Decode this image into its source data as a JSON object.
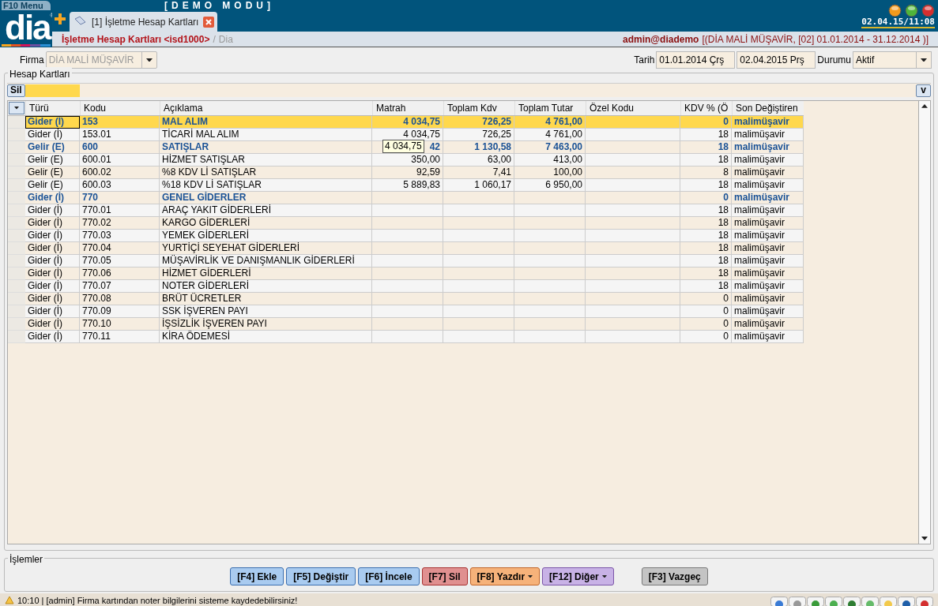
{
  "title_bar": {
    "menu_button": "F10 Menu",
    "mode_banner": "[DEMO MODU]",
    "clock": "02.04.15/11:08"
  },
  "logo": {
    "text": "dia",
    "mark": "®"
  },
  "tabs": [
    {
      "label": "[1] İşletme Hesap Kartları",
      "selected": true
    }
  ],
  "breadcrumb": {
    "title": "İşletme Hesap Kartları <isd1000>",
    "separator": "/",
    "module": "Dia",
    "user": "admin@diademo",
    "context": "[(DİA MALİ MÜŞAVİR, [02] 01.01.2014 - 31.12.2014 )]"
  },
  "filters": {
    "firma_label": "Firma",
    "firma_value": "DİA MALİ MÜŞAVİR",
    "firma_disabled": true,
    "tarih_label": "Tarih",
    "date_from": "01.01.2014 Çrş",
    "date_to": "02.04.2015 Prş",
    "durum_label": "Durumu",
    "durum_value": "Aktif"
  },
  "grid": {
    "group_title": "Hesap Kartları",
    "delete_button": "Sil",
    "filter_menu_button": "v",
    "columns": [
      "Türü",
      "Kodu",
      "Açıklama",
      "Matrah",
      "Toplam Kdv",
      "Toplam Tutar",
      "Özel Kodu",
      "KDV % (Ö",
      "Son Değiştiren"
    ],
    "rows": [
      {
        "kind": "group",
        "selected": true,
        "cells": [
          "Gider (İ)",
          "153",
          "MAL ALIM",
          "4 034,75",
          "726,25",
          "4 761,00",
          "",
          "0",
          "malimüşavir"
        ]
      },
      {
        "kind": "item",
        "selected": false,
        "cells": [
          "Gider (İ)",
          "153.01",
          "TİCARİ MAL ALIM",
          "4 034,75",
          "726,25",
          "4 761,00",
          "",
          "18",
          "malimüşavir"
        ]
      },
      {
        "kind": "group",
        "selected": false,
        "cells": [
          "Gelir (E)",
          "600",
          "SATIŞLAR",
          "42",
          "1 130,58",
          "7 463,00",
          "",
          "18",
          "malimüşavir"
        ]
      },
      {
        "kind": "item",
        "selected": false,
        "cells": [
          "Gelir (E)",
          "600.01",
          "HİZMET SATIŞLAR",
          "350,00",
          "63,00",
          "413,00",
          "",
          "18",
          "malimüşavir"
        ]
      },
      {
        "kind": "item",
        "selected": false,
        "cells": [
          "Gelir (E)",
          "600.02",
          "%8 KDV Lİ SATIŞLAR",
          "92,59",
          "7,41",
          "100,00",
          "",
          "8",
          "malimüşavir"
        ]
      },
      {
        "kind": "item",
        "selected": false,
        "cells": [
          "Gelir (E)",
          "600.03",
          "%18 KDV Lİ SATIŞLAR",
          "5 889,83",
          "1 060,17",
          "6 950,00",
          "",
          "18",
          "malimüşavir"
        ]
      },
      {
        "kind": "group",
        "selected": false,
        "cells": [
          "Gider (İ)",
          "770",
          "GENEL GİDERLER",
          "",
          "",
          "",
          "",
          "0",
          "malimüşavir"
        ]
      },
      {
        "kind": "item",
        "selected": false,
        "cells": [
          "Gider (İ)",
          "770.01",
          "ARAÇ YAKIT GİDERLERİ",
          "",
          "",
          "",
          "",
          "18",
          "malimüşavir"
        ]
      },
      {
        "kind": "item",
        "selected": false,
        "cells": [
          "Gider (İ)",
          "770.02",
          "KARGO GİDERLERİ",
          "",
          "",
          "",
          "",
          "18",
          "malimüşavir"
        ]
      },
      {
        "kind": "item",
        "selected": false,
        "cells": [
          "Gider (İ)",
          "770.03",
          "YEMEK GİDERLERİ",
          "",
          "",
          "",
          "",
          "18",
          "malimüşavir"
        ]
      },
      {
        "kind": "item",
        "selected": false,
        "cells": [
          "Gider (İ)",
          "770.04",
          "YURTİÇİ SEYEHAT GİDERLERİ",
          "",
          "",
          "",
          "",
          "18",
          "malimüşavir"
        ]
      },
      {
        "kind": "item",
        "selected": false,
        "cells": [
          "Gider (İ)",
          "770.05",
          "MÜŞAVİRLİK VE DANIŞMANLIK GİDERLERİ",
          "",
          "",
          "",
          "",
          "18",
          "malimüşavir"
        ]
      },
      {
        "kind": "item",
        "selected": false,
        "cells": [
          "Gider (İ)",
          "770.06",
          "HİZMET GİDERLERİ",
          "",
          "",
          "",
          "",
          "18",
          "malimüşavir"
        ]
      },
      {
        "kind": "item",
        "selected": false,
        "cells": [
          "Gider (İ)",
          "770.07",
          "NOTER GİDERLERİ",
          "",
          "",
          "",
          "",
          "18",
          "malimüşavir"
        ]
      },
      {
        "kind": "item",
        "selected": false,
        "cells": [
          "Gider (İ)",
          "770.08",
          "BRÜT ÜCRETLER",
          "",
          "",
          "",
          "",
          "0",
          "malimüşavir"
        ]
      },
      {
        "kind": "item",
        "selected": false,
        "cells": [
          "Gider (İ)",
          "770.09",
          "SSK İŞVEREN PAYI",
          "",
          "",
          "",
          "",
          "0",
          "malimüşavir"
        ]
      },
      {
        "kind": "item",
        "selected": false,
        "cells": [
          "Gider (İ)",
          "770.10",
          "İŞSİZLİK İŞVEREN PAYI",
          "",
          "",
          "",
          "",
          "0",
          "malimüşavir"
        ]
      },
      {
        "kind": "item",
        "selected": false,
        "cells": [
          "Gider (İ)",
          "770.11",
          "KİRA ÖDEMESİ",
          "",
          "",
          "",
          "",
          "0",
          "malimüşavir"
        ]
      }
    ],
    "tooltip": "4 034,75"
  },
  "actions": {
    "group_title": "İşlemler",
    "buttons": [
      {
        "label": "[F4] Ekle",
        "kind": "blue",
        "has_menu": false
      },
      {
        "label": "[F5] Değiştir",
        "kind": "blue",
        "has_menu": false
      },
      {
        "label": "[F6] İncele",
        "kind": "blue",
        "has_menu": false
      },
      {
        "label": "[F7] Sil",
        "kind": "red",
        "has_menu": false
      },
      {
        "label": "[F8] Yazdır",
        "kind": "orange",
        "has_menu": true
      },
      {
        "label": "[F12] Diğer",
        "kind": "purple",
        "has_menu": true
      },
      {
        "label": "[F3] Vazgeç",
        "kind": "gray",
        "has_menu": false
      }
    ]
  },
  "status_bar": {
    "message": "10:10 | [admin] Firma kartından noter bilgilerini sisteme kaydedebilirsiniz!"
  }
}
